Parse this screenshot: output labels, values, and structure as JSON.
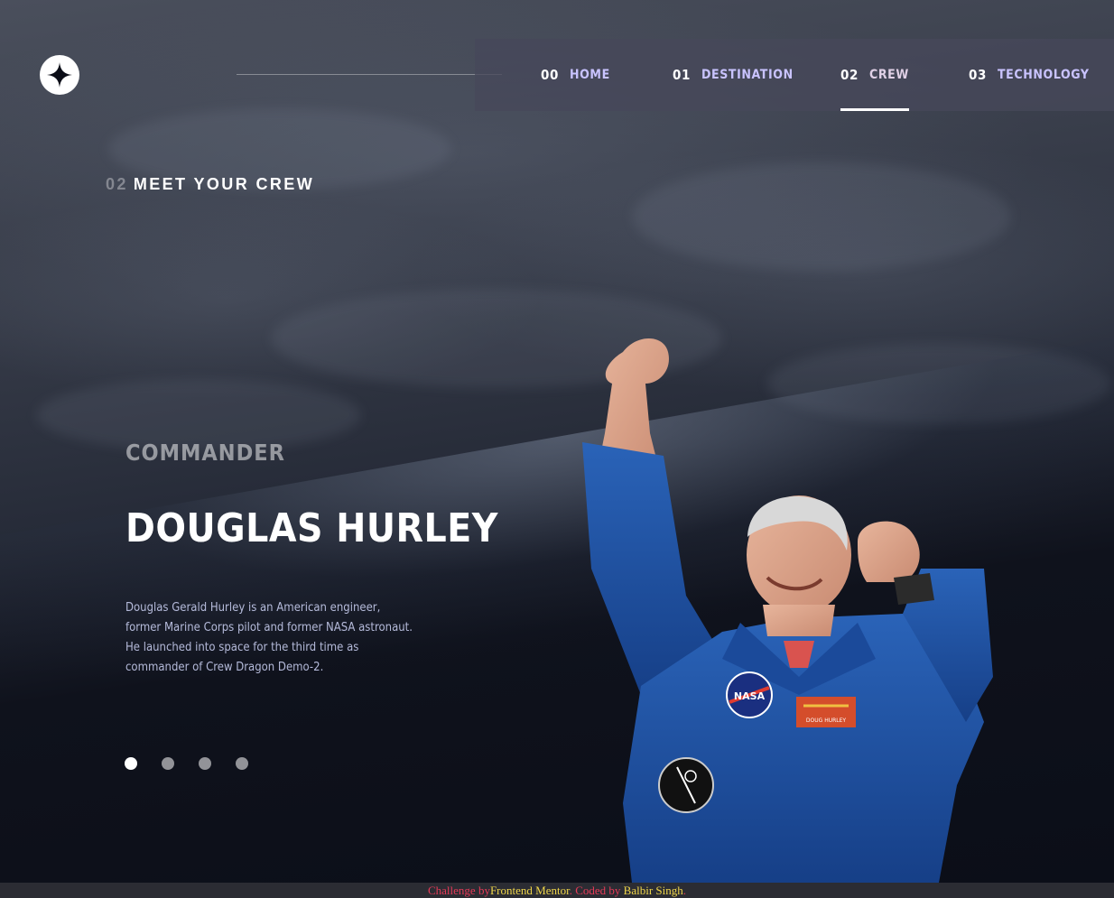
{
  "nav": {
    "items": [
      {
        "number": "00",
        "label": "HOME"
      },
      {
        "number": "01",
        "label": "DESTINATION"
      },
      {
        "number": "02",
        "label": "CREW"
      },
      {
        "number": "03",
        "label": "TECHNOLOGY"
      }
    ],
    "active_index": 2
  },
  "page": {
    "heading_number": "02",
    "heading_text": "MEET YOUR CREW"
  },
  "crew": {
    "role": "COMMANDER",
    "name": "DOUGLAS HURLEY",
    "bio": "Douglas Gerald Hurley is an American engineer, former Marine Corps pilot and former NASA astronaut. He launched into space for the third time as commander of Crew Dragon Demo-2.",
    "dot_count": 4,
    "active_dot": 0,
    "patch_text": "NASA",
    "nametag_text": "DOUG HURLEY"
  },
  "footer": {
    "prefix": "Challenge by",
    "challenge_link": "Frontend Mentor",
    "middle": ". Coded by ",
    "author_link": "Balbir Singh",
    "suffix": "."
  },
  "colors": {
    "background": "#0b0d17",
    "nav_background": "#46485a",
    "footer_text": "#e63a58",
    "footer_link": "#f0d64a",
    "suit_blue": "#1f54a8"
  },
  "icons": {
    "logo": "star-logo-icon"
  }
}
